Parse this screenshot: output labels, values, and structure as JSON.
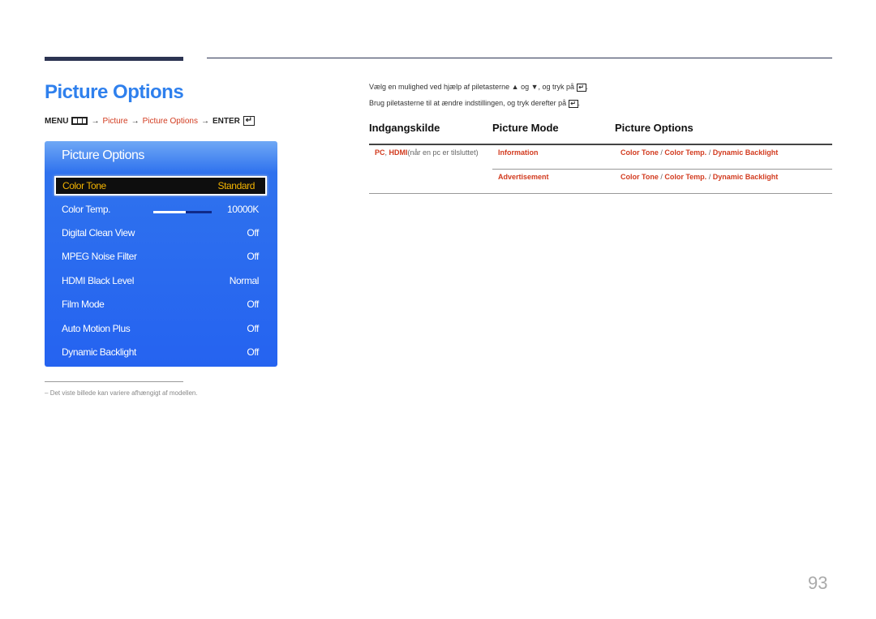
{
  "page": {
    "title": "Picture Options",
    "page_number": "93"
  },
  "menu_path": {
    "menu": "MENU",
    "arrow": "→",
    "step1": "Picture",
    "step2": "Picture Options",
    "enter": "ENTER"
  },
  "osd": {
    "title": "Picture Options",
    "rows": [
      {
        "label": "Color Tone",
        "value": "Standard",
        "selected": true
      },
      {
        "label": "Color Temp.",
        "value": "10000K",
        "slider_fraction": 0.55
      },
      {
        "label": "Digital Clean View",
        "value": "Off"
      },
      {
        "label": "MPEG Noise Filter",
        "value": "Off"
      },
      {
        "label": "HDMI Black Level",
        "value": "Normal"
      },
      {
        "label": "Film Mode",
        "value": "Off"
      },
      {
        "label": "Auto Motion Plus",
        "value": "Off"
      },
      {
        "label": "Dynamic Backlight",
        "value": "Off"
      }
    ]
  },
  "footnote": "Det viste billede kan variere afhængigt af modellen.",
  "footnote_dash": "–",
  "instructions": {
    "line1_a": "Vælg en mulighed ved hjælp af piletasterne",
    "up": "▲",
    "og": "og",
    "down": "▼",
    "line1_b": ", og tryk på",
    "line2": "Brug piletasterne til at ændre indstillingen, og tryk derefter på",
    "period": "."
  },
  "table": {
    "headers": [
      "Indgangskilde",
      "Picture Mode",
      "Picture Options"
    ],
    "source": {
      "pc": "PC",
      "sep": ", ",
      "hdmi": "HDMI",
      "note": "(når en pc er tilsluttet)"
    },
    "rows": [
      {
        "mode": "Information",
        "options": [
          "Color Tone",
          "Color Temp.",
          "Dynamic Backlight"
        ]
      },
      {
        "mode": "Advertisement",
        "options": [
          "Color Tone",
          "Color Temp.",
          "Dynamic Backlight"
        ]
      }
    ],
    "slash": " / "
  },
  "colors": {
    "title_blue": "#2f80ed",
    "link_red": "#d23b1f",
    "osd_blue": "#2563f0",
    "selected_text": "#f4b400"
  }
}
